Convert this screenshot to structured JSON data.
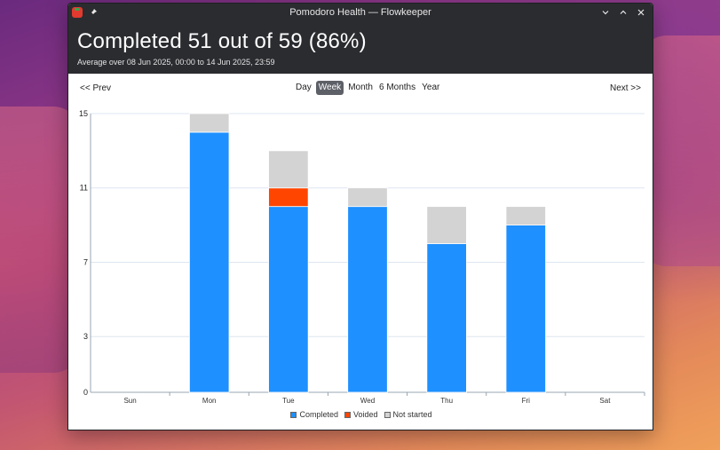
{
  "window": {
    "title": "Pomodoro Health — Flowkeeper"
  },
  "header": {
    "headline": "Completed 51 out of 59 (86%)",
    "subtitle": "Average over 08 Jun 2025, 00:00 to 14 Jun 2025, 23:59"
  },
  "nav": {
    "prev": "<< Prev",
    "next": "Next >>",
    "periods": [
      "Day",
      "Week",
      "Month",
      "6 Months",
      "Year"
    ],
    "active_period": "Week"
  },
  "colors": {
    "completed": "#1e90ff",
    "voided": "#ff4500",
    "not_started": "#d3d3d3",
    "grid": "#dde6f0"
  },
  "icons": {
    "app": "tomato-icon",
    "pin": "pin-icon",
    "minimize": "chevron-down-icon",
    "maximize": "chevron-up-icon",
    "close": "close-icon"
  },
  "chart_data": {
    "type": "bar",
    "stacked": true,
    "categories": [
      "Sun",
      "Mon",
      "Tue",
      "Wed",
      "Thu",
      "Fri",
      "Sat"
    ],
    "series": [
      {
        "name": "Completed",
        "values": [
          0,
          14,
          10,
          10,
          8,
          9,
          0
        ]
      },
      {
        "name": "Voided",
        "values": [
          0,
          0,
          1,
          0,
          0,
          0,
          0
        ]
      },
      {
        "name": "Not started",
        "values": [
          0,
          1,
          2,
          1,
          2,
          1,
          0
        ]
      }
    ],
    "yticks": [
      "0",
      "3",
      "7",
      "11",
      "15"
    ],
    "ylim": [
      0,
      15
    ],
    "grid": true,
    "legend_position": "bottom"
  }
}
